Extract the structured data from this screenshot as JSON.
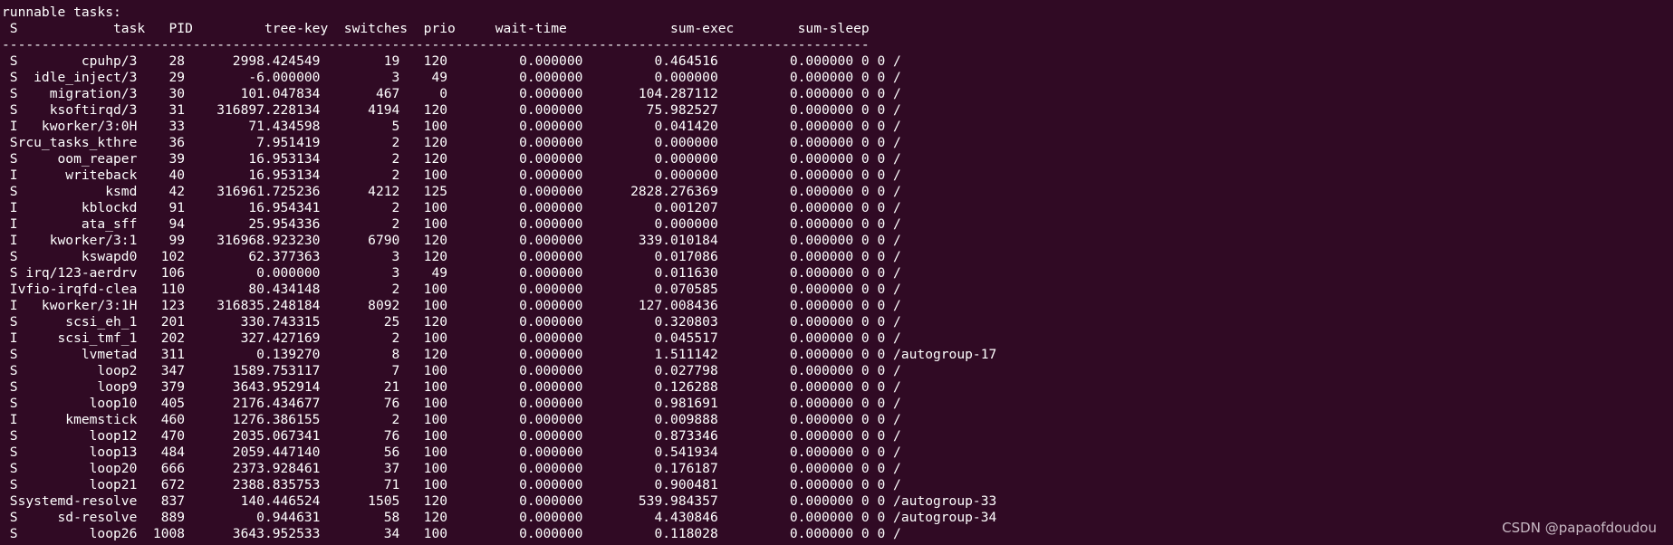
{
  "terminal": {
    "background": "#300a24",
    "foreground": "#ffffff",
    "title_line": "runnable tasks:",
    "header_line": " S            task   PID         tree-key  switches  prio     wait-time             sum-exec        sum-sleep",
    "separator_line": "-------------------------------------------------------------------------------------------------------------",
    "rows": [
      " S        cpuhp/3    28      2998.424549        19   120         0.000000         0.464516         0.000000 0 0 /",
      " S  idle_inject/3    29        -6.000000         3    49         0.000000         0.000000         0.000000 0 0 /",
      " S    migration/3    30       101.047834       467     0         0.000000       104.287112         0.000000 0 0 /",
      " S    ksoftirqd/3    31    316897.228134      4194   120         0.000000        75.982527         0.000000 0 0 /",
      " I   kworker/3:0H    33        71.434598         5   100         0.000000         0.041420         0.000000 0 0 /",
      " Srcu_tasks_kthre    36         7.951419         2   120         0.000000         0.000000         0.000000 0 0 /",
      " S     oom_reaper    39        16.953134         2   120         0.000000         0.000000         0.000000 0 0 /",
      " I      writeback    40        16.953134         2   100         0.000000         0.000000         0.000000 0 0 /",
      " S           ksmd    42    316961.725236      4212   125         0.000000      2828.276369         0.000000 0 0 /",
      " I        kblockd    91        16.954341         2   100         0.000000         0.001207         0.000000 0 0 /",
      " I        ata_sff    94        25.954336         2   100         0.000000         0.000000         0.000000 0 0 /",
      " I    kworker/3:1    99    316968.923230      6790   120         0.000000       339.010184         0.000000 0 0 /",
      " S        kswapd0   102        62.377363         3   120         0.000000         0.017086         0.000000 0 0 /",
      " S irq/123-aerdrv   106         0.000000         3    49         0.000000         0.011630         0.000000 0 0 /",
      " Ivfio-irqfd-clea   110        80.434148         2   100         0.000000         0.070585         0.000000 0 0 /",
      " I   kworker/3:1H   123    316835.248184      8092   100         0.000000       127.008436         0.000000 0 0 /",
      " S      scsi_eh_1   201       330.743315        25   120         0.000000         0.320803         0.000000 0 0 /",
      " I     scsi_tmf_1   202       327.427169         2   100         0.000000         0.045517         0.000000 0 0 /",
      " S        lvmetad   311         0.139270         8   120         0.000000         1.511142         0.000000 0 0 /autogroup-17",
      " S          loop2   347      1589.753117         7   100         0.000000         0.027798         0.000000 0 0 /",
      " S          loop9   379      3643.952914        21   100         0.000000         0.126288         0.000000 0 0 /",
      " S         loop10   405      2176.434677        76   100         0.000000         0.981691         0.000000 0 0 /",
      " I      kmemstick   460      1276.386155         2   100         0.000000         0.009888         0.000000 0 0 /",
      " S         loop12   470      2035.067341        76   100         0.000000         0.873346         0.000000 0 0 /",
      " S         loop13   484      2059.447140        56   100         0.000000         0.541934         0.000000 0 0 /",
      " S         loop20   666      2373.928461        37   100         0.000000         0.176187         0.000000 0 0 /",
      " S         loop21   672      2388.835753        71   100         0.000000         0.900481         0.000000 0 0 /",
      " Ssystemd-resolve   837       140.446524      1505   120         0.000000       539.984357         0.000000 0 0 /autogroup-33",
      " S     sd-resolve   889         0.944631        58   120         0.000000         4.430846         0.000000 0 0 /autogroup-34",
      " S         loop26  1008      3643.952533        34   100         0.000000         0.118028         0.000000 0 0 /"
    ]
  },
  "watermark": "CSDN @papaofdoudou"
}
